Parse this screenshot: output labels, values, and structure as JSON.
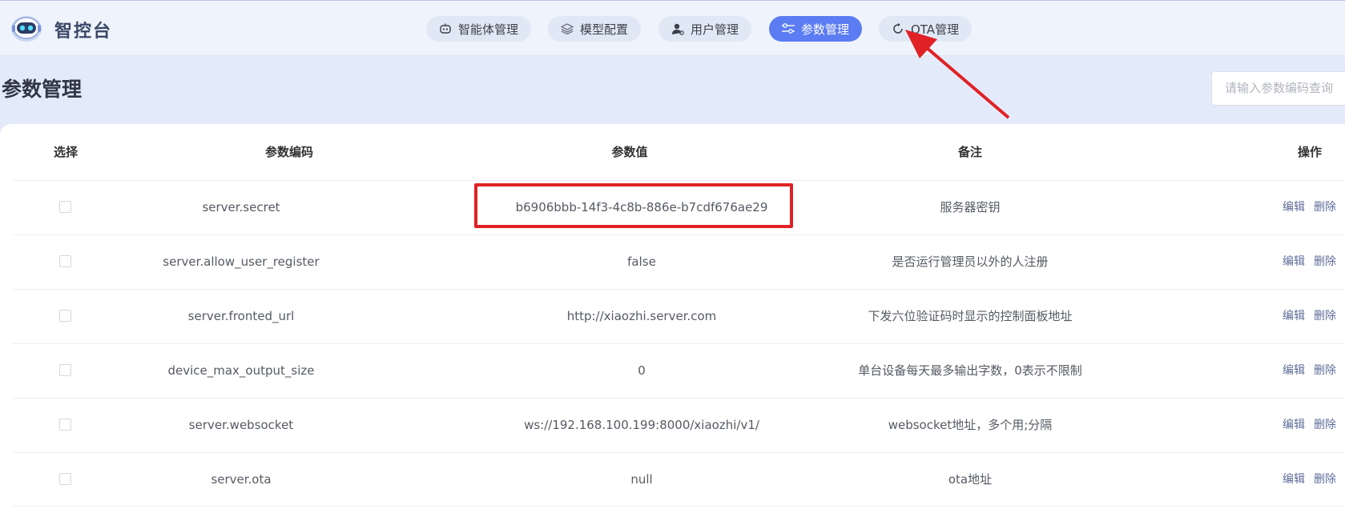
{
  "app": {
    "brand": "智控台"
  },
  "nav": [
    {
      "label": "智能体管理",
      "icon": "robot-icon",
      "active": false
    },
    {
      "label": "模型配置",
      "icon": "layers-icon",
      "active": false
    },
    {
      "label": "用户管理",
      "icon": "user-icon",
      "active": false
    },
    {
      "label": "参数管理",
      "icon": "sliders-icon",
      "active": true
    },
    {
      "label": "OTA管理",
      "icon": "refresh-icon",
      "active": false
    }
  ],
  "page": {
    "title": "参数管理",
    "search_placeholder": "请输入参数编码查询"
  },
  "table": {
    "headers": {
      "select": "选择",
      "code": "参数编码",
      "value": "参数值",
      "remark": "备注",
      "ops": "操作"
    },
    "rows": [
      {
        "code": "server.secret",
        "value": "b6906bbb-14f3-4c8b-886e-b7cdf676ae29",
        "remark": "服务器密钥",
        "edit": "编辑",
        "delete": "删除"
      },
      {
        "code": "server.allow_user_register",
        "value": "false",
        "remark": "是否运行管理员以外的人注册",
        "edit": "编辑",
        "delete": "删除"
      },
      {
        "code": "server.fronted_url",
        "value": "http://xiaozhi.server.com",
        "remark": "下发六位验证码时显示的控制面板地址",
        "edit": "编辑",
        "delete": "删除"
      },
      {
        "code": "device_max_output_size",
        "value": "0",
        "remark": "单台设备每天最多输出字数，0表示不限制",
        "edit": "编辑",
        "delete": "删除"
      },
      {
        "code": "server.websocket",
        "value": "ws://192.168.100.199:8000/xiaozhi/v1/",
        "remark": "websocket地址，多个用;分隔",
        "edit": "编辑",
        "delete": "删除"
      },
      {
        "code": "server.ota",
        "value": "null",
        "remark": "ota地址",
        "edit": "编辑",
        "delete": "删除"
      }
    ]
  },
  "annotation": {
    "highlight_color": "#e02226",
    "arrow_color": "#e02226"
  }
}
